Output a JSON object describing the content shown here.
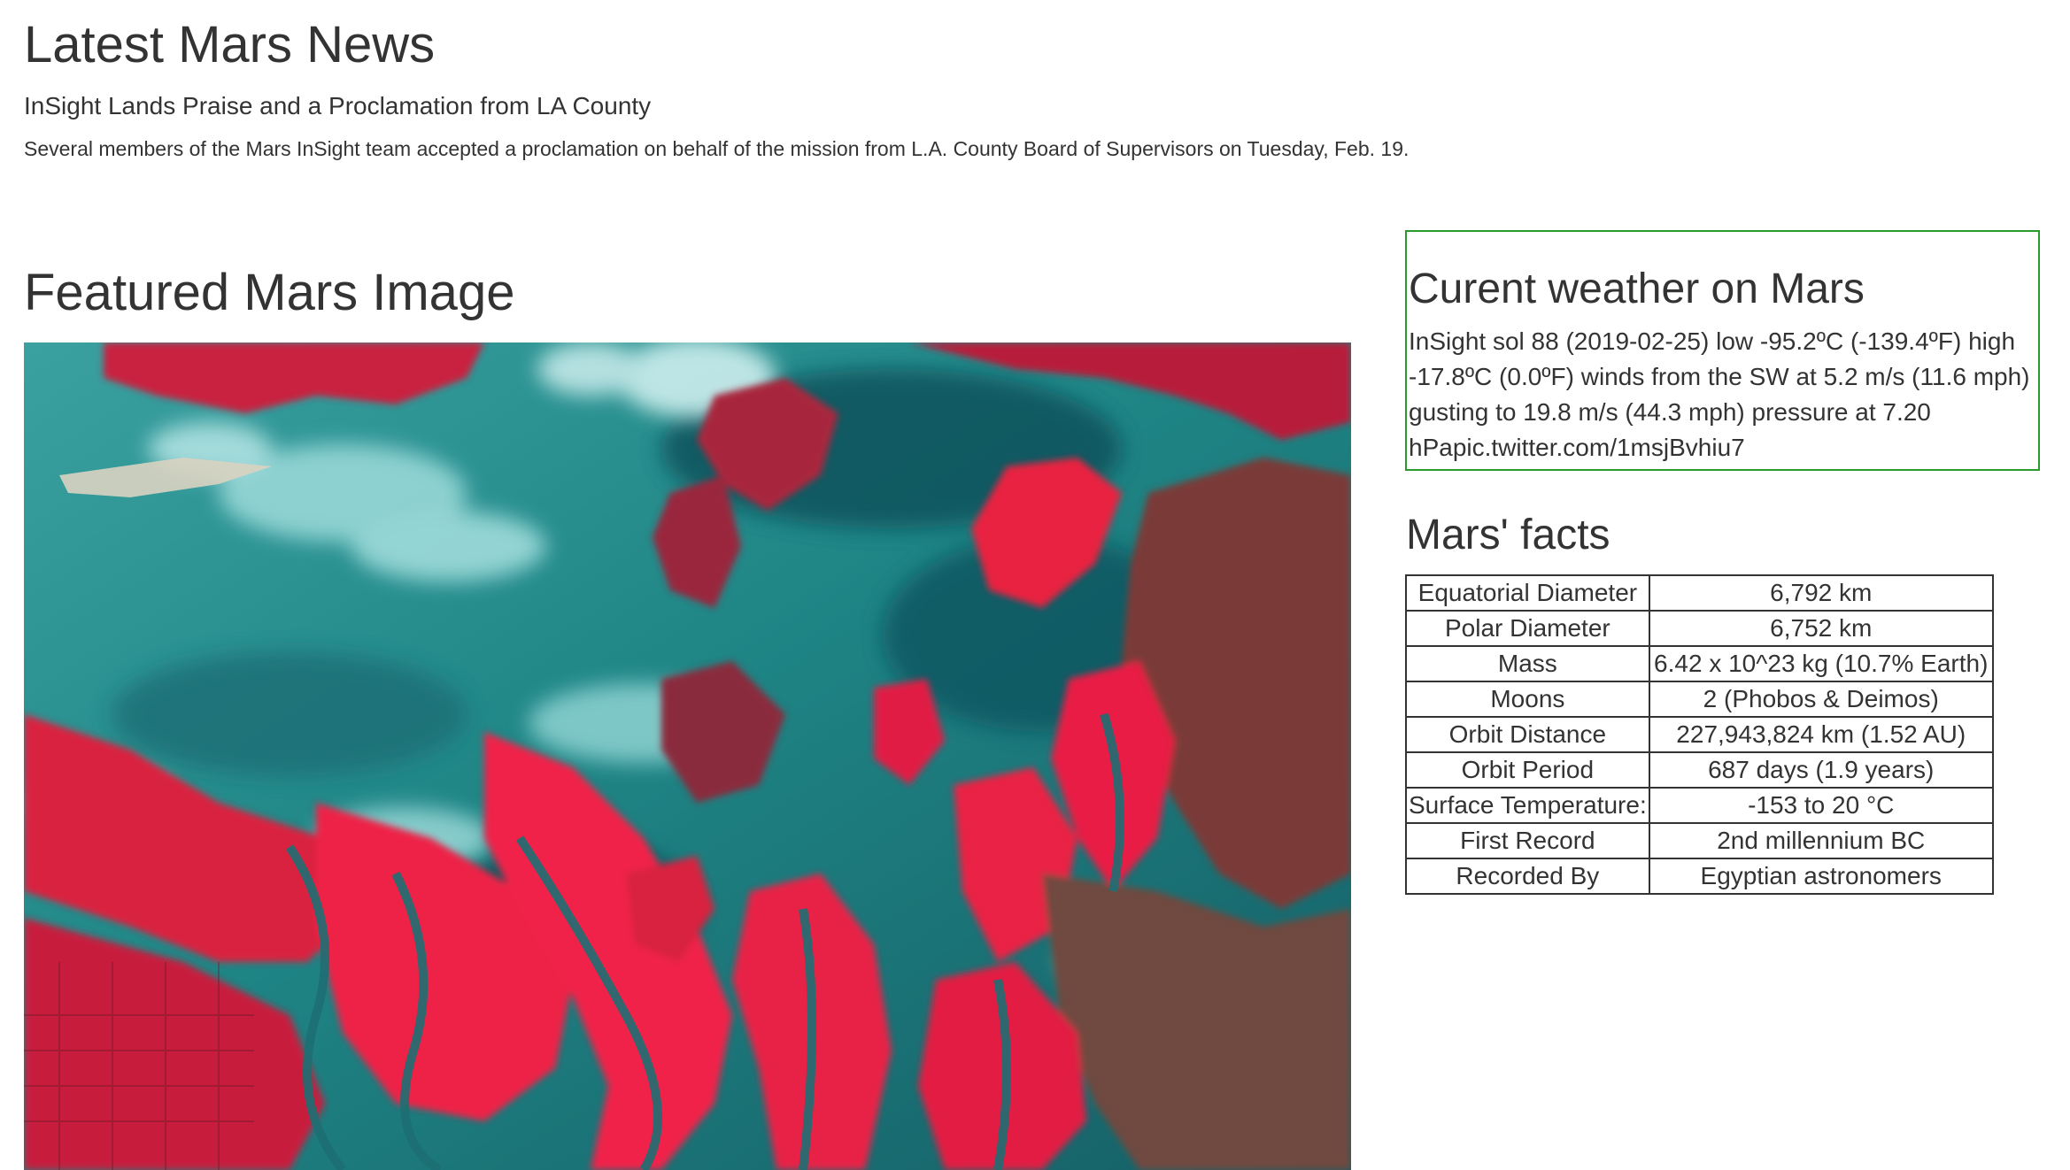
{
  "news": {
    "section_title": "Latest Mars News",
    "headline": "InSight Lands Praise and a Proclamation from LA County",
    "paragraph": "Several members of the Mars InSight team accepted a proclamation on behalf of the mission from L.A. County Board of Supervisors on Tuesday, Feb. 19."
  },
  "featured": {
    "section_title": "Featured Mars Image"
  },
  "weather": {
    "title": "Curent weather on Mars",
    "text": "InSight sol 88 (2019-02-25) low -95.2ºC (-139.4ºF) high -17.8ºC (0.0ºF) winds from the SW at 5.2 m/s (11.6 mph) gusting to 19.8 m/s (44.3 mph) pressure at 7.20 hPapic.twitter.com/1msjBvhiu7"
  },
  "facts": {
    "title": "Mars' facts",
    "rows": [
      {
        "label": "Equatorial Diameter",
        "value": "6,792 km"
      },
      {
        "label": "Polar Diameter",
        "value": "6,752 km"
      },
      {
        "label": "Mass",
        "value": "6.42 x 10^23 kg (10.7% Earth)"
      },
      {
        "label": "Moons",
        "value": "2 (Phobos & Deimos)"
      },
      {
        "label": "Orbit Distance",
        "value": "227,943,824 km (1.52 AU)"
      },
      {
        "label": "Orbit Period",
        "value": "687 days (1.9 years)"
      },
      {
        "label": "Surface Temperature:",
        "value": "-153 to 20 °C"
      },
      {
        "label": "First Record",
        "value": "2nd millennium BC"
      },
      {
        "label": "Recorded By",
        "value": "Egyptian astronomers"
      }
    ]
  },
  "colors": {
    "weather_border": "#2a9a2a",
    "text": "#333333",
    "table_border": "#333333"
  }
}
